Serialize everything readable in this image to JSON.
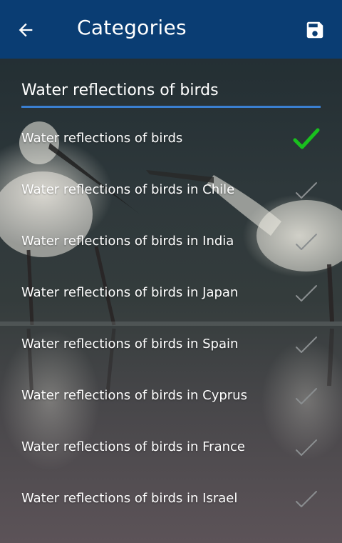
{
  "header": {
    "title": "Categories",
    "back_icon": "arrow-left-icon",
    "save_icon": "floppy-disk-icon"
  },
  "search": {
    "value": "Water reflections of birds"
  },
  "categories": [
    {
      "label": "Water reflections of birds",
      "selected": true
    },
    {
      "label": "Water reflections of birds in Chile",
      "selected": false
    },
    {
      "label": "Water reflections of birds in India",
      "selected": false
    },
    {
      "label": "Water reflections of birds in Japan",
      "selected": false
    },
    {
      "label": "Water reflections of birds in Spain",
      "selected": false
    },
    {
      "label": "Water reflections of birds in Cyprus",
      "selected": false
    },
    {
      "label": "Water reflections of birds in France",
      "selected": false
    },
    {
      "label": "Water reflections of birds in Israel",
      "selected": false
    }
  ],
  "colors": {
    "appbar": "#0a3d73",
    "underline": "#3a7fd0",
    "check_selected": "#19c01e",
    "check_unselected": "#8a8e90"
  }
}
